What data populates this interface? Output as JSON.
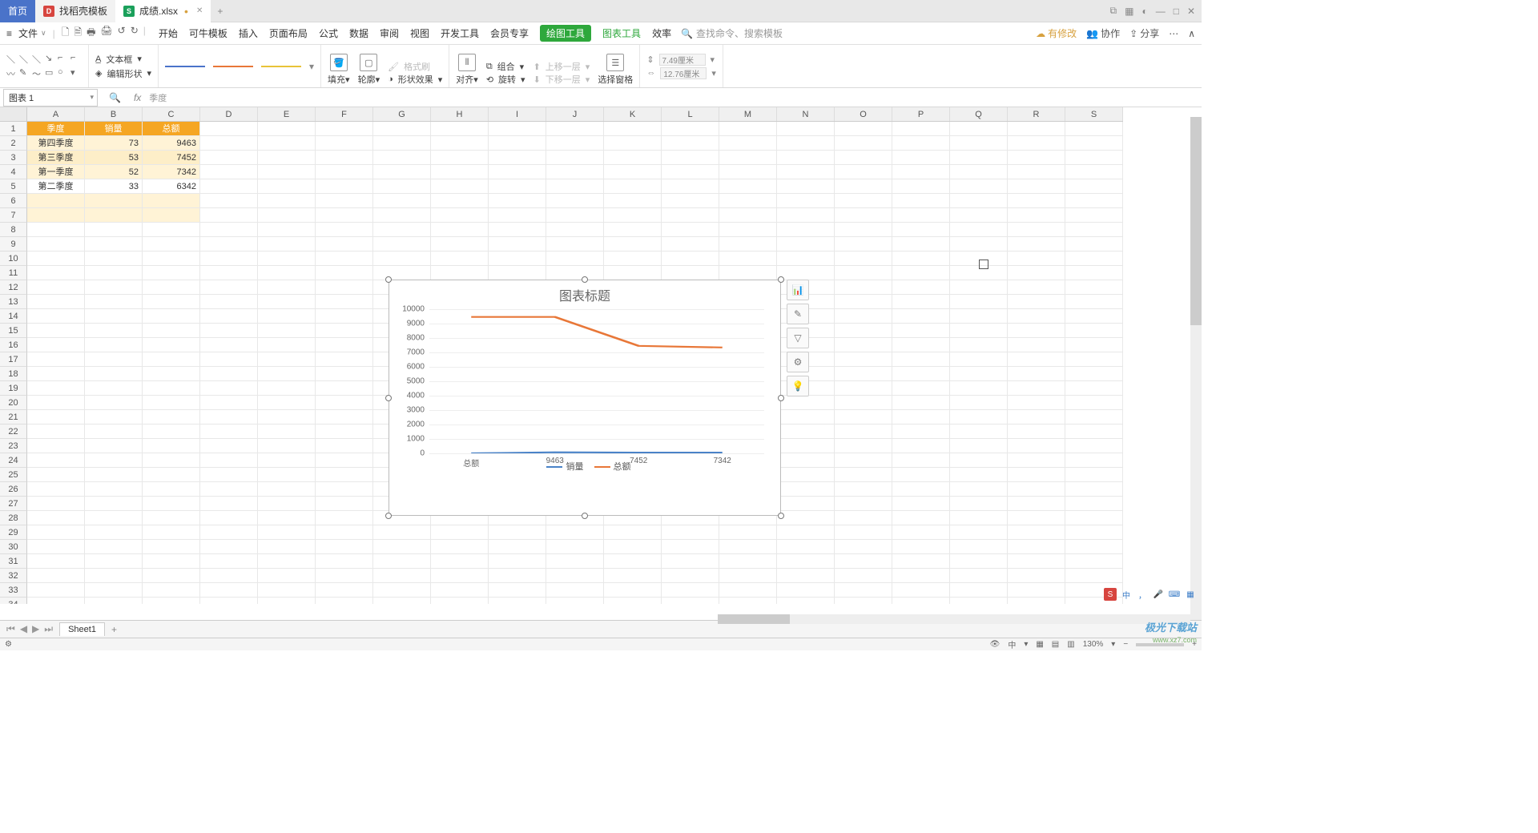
{
  "tabs": {
    "home": "首页",
    "docer": "找稻壳模板",
    "file": "成绩.xlsx",
    "modified": "•",
    "add": "+"
  },
  "window_controls": {
    "layout": "⧉",
    "grid": "▦",
    "avatar": "◐",
    "min": "—",
    "max": "□",
    "close": "✕"
  },
  "menu": {
    "hamburger": "≡",
    "file": "文件",
    "dd": "∨",
    "qat": [
      "🗋",
      "🗎",
      "🖶",
      "🖨",
      "↺",
      "↻"
    ],
    "tabs": [
      "开始",
      "可牛模板",
      "插入",
      "页面布局",
      "公式",
      "数据",
      "审阅",
      "视图",
      "开发工具",
      "会员专享"
    ],
    "context1": "绘图工具",
    "context2": "图表工具",
    "context3": "效率",
    "search_icon": "🔍",
    "search_placeholder": "查找命令、搜索模板",
    "right": {
      "cloud_icon": "☁",
      "cloud": "有修改",
      "collab_icon": "👥",
      "collab": "协作",
      "share_icon": "⇪",
      "share": "分享",
      "more": "⋯",
      "chev": "∧"
    }
  },
  "ribbon": {
    "textbox": "文本框",
    "editshape": "编辑形状",
    "fill": "填充",
    "outline": "轮廓",
    "effect": "形状效果",
    "formatpainter": "格式刷",
    "align": "对齐",
    "group": "组合",
    "rotate": "旋转",
    "up": "上移一层",
    "down": "下移一层",
    "pane": "选择窗格",
    "h": "7.49厘米",
    "w": "12.76厘米"
  },
  "namebox": "图表 1",
  "formula": "季度",
  "columns": [
    "A",
    "B",
    "C",
    "D",
    "E",
    "F",
    "G",
    "H",
    "I",
    "J",
    "K",
    "L",
    "M",
    "N",
    "O",
    "P",
    "Q",
    "R",
    "S"
  ],
  "data_table": {
    "headers": [
      "季度",
      "销量",
      "总额"
    ],
    "rows": [
      [
        "第四季度",
        "73",
        "9463"
      ],
      [
        "第三季度",
        "53",
        "7452"
      ],
      [
        "第一季度",
        "52",
        "7342"
      ],
      [
        "第二季度",
        "33",
        "6342"
      ]
    ]
  },
  "chart_data": {
    "type": "line",
    "title": "图表标题",
    "x_categories": [
      "总额",
      "9463",
      "7452",
      "7342"
    ],
    "series": [
      {
        "name": "销量",
        "color": "#4a83c8",
        "values": [
          0,
          73,
          53,
          52
        ]
      },
      {
        "name": "总额",
        "color": "#e87738",
        "values": [
          9463,
          9463,
          7452,
          7342
        ]
      }
    ],
    "ylim": [
      0,
      10000
    ],
    "yticks": [
      0,
      1000,
      2000,
      3000,
      4000,
      5000,
      6000,
      7000,
      8000,
      9000,
      10000
    ],
    "legend": [
      "销量",
      "总额"
    ]
  },
  "chart_side": [
    "📊",
    "✎",
    "▽",
    "⚙",
    "💡"
  ],
  "sheet": {
    "name": "Sheet1",
    "add": "+"
  },
  "status": {
    "zoom": "130%",
    "minus": "−",
    "plus": "+",
    "eye": "👁",
    "cn": "中",
    "views": [
      "▦",
      "▤",
      "▥"
    ]
  },
  "ime": {
    "logo": "S",
    "cn": "中",
    "comma": "，",
    "mic": "🎤",
    "kbd": "⌨",
    "grid": "▦"
  },
  "watermark": "极光下载站",
  "watermark2": "www.xz7.com"
}
